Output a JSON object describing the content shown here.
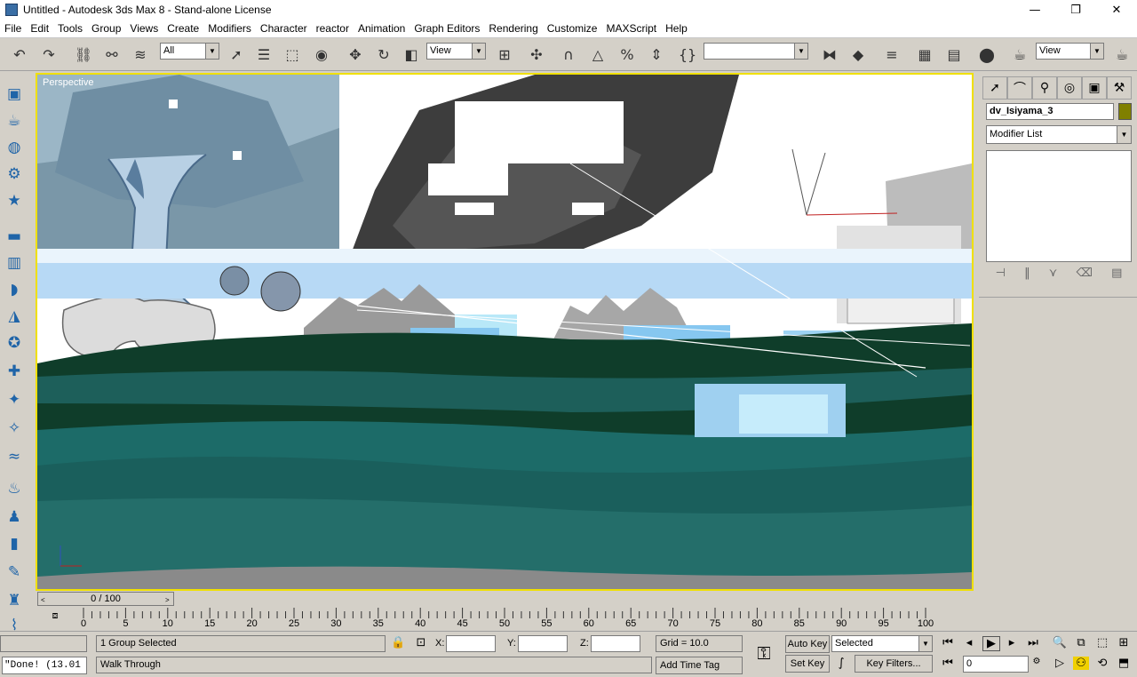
{
  "window": {
    "title": "Untitled - Autodesk 3ds Max 8 - Stand-alone License"
  },
  "window_buttons": {
    "minimize": "—",
    "maximize": "❐",
    "close": "✕"
  },
  "menu": [
    "File",
    "Edit",
    "Tools",
    "Group",
    "Views",
    "Create",
    "Modifiers",
    "Character",
    "reactor",
    "Animation",
    "Graph Editors",
    "Rendering",
    "Customize",
    "MAXScript",
    "Help"
  ],
  "toolbar": {
    "selection_filter": "All",
    "ref_coord": "View",
    "named_selection": "",
    "render_view": "View"
  },
  "viewport": {
    "label": "Perspective"
  },
  "command_panel": {
    "object_name": "dv_Isiyama_3",
    "modifier_list": "Modifier List",
    "object_color": "#808000"
  },
  "time_slider": {
    "label": "0 / 100",
    "prev": "<",
    "next": ">"
  },
  "timeline": {
    "ticks": [
      "0",
      "5",
      "10",
      "15",
      "20",
      "25",
      "30",
      "35",
      "40",
      "45",
      "50",
      "55",
      "60",
      "65",
      "70",
      "75",
      "80",
      "85",
      "90",
      "95",
      "100"
    ]
  },
  "status": {
    "selection_info": "1 Group Selected",
    "prompt": "Walk Through",
    "x_label": "X:",
    "y_label": "Y:",
    "z_label": "Z:",
    "x_value": "",
    "y_value": "",
    "z_value": "",
    "grid": "Grid = 10.0",
    "add_time_tag": "Add Time Tag",
    "auto_key": "Auto Key",
    "set_key": "Set Key",
    "key_mode": "Selected",
    "key_filters": "Key Filters...",
    "frame": "0",
    "listener": "\"Done! (13.01"
  },
  "colors": {
    "viewport_border": "#f0e000",
    "water": "#1c6b68",
    "dark_hill": "#0f3d2a"
  }
}
